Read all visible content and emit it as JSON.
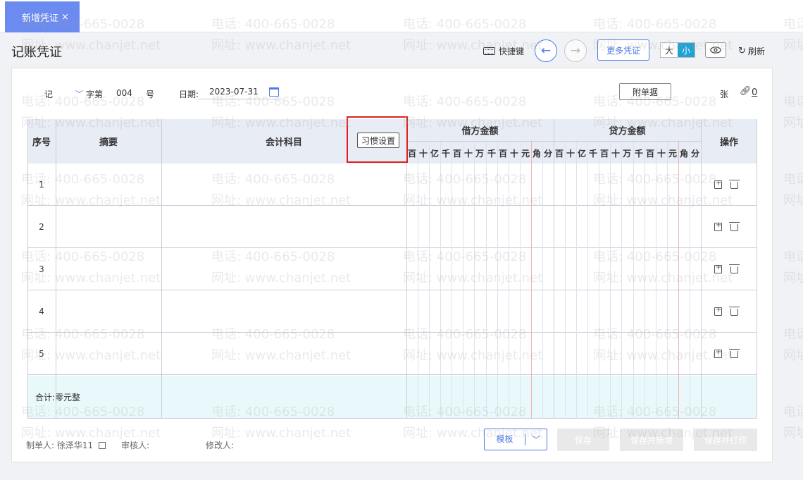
{
  "tab": {
    "label": "新增凭证",
    "close": "×"
  },
  "header": {
    "title": "记账凭证",
    "shortcut": "快捷键",
    "prev_icon": "arrow-left-icon",
    "next_icon": "arrow-right-icon",
    "more": "更多凭证",
    "size_large": "大",
    "size_small": "小",
    "refresh": "刷新"
  },
  "meta": {
    "voucher_type": "记",
    "zi": "字第",
    "number": "004",
    "hao": "号",
    "date_label": "日期:",
    "date": "2023-07-31",
    "attach_btn": "附单据",
    "zhang": "张",
    "attach_count": "0"
  },
  "table": {
    "col_seq": "序号",
    "col_summary": "摘要",
    "col_account": "会计科目",
    "habit_btn": "习惯设置",
    "col_debit": "借方金额",
    "col_credit": "贷方金额",
    "col_ops": "操作",
    "digits": [
      "百",
      "十",
      "亿",
      "千",
      "百",
      "十",
      "万",
      "千",
      "百",
      "十",
      "元",
      "角",
      "分"
    ],
    "rows": [
      {
        "seq": "1"
      },
      {
        "seq": "2"
      },
      {
        "seq": "3"
      },
      {
        "seq": "4"
      },
      {
        "seq": "5"
      }
    ],
    "total_label": "合计:零元整"
  },
  "footer": {
    "maker_label": "制单人:",
    "maker": "徐泽华11",
    "reviewer_label": "审核人:",
    "modifier_label": "修改人:",
    "template": "模板",
    "save": "保存",
    "save_new": "保存并新增",
    "save_print": "保存并打印"
  },
  "watermark": {
    "phone": "电话: 400-665-0028",
    "site": "网址: www.chanjet.net"
  },
  "colors": {
    "accent": "#4e7be8",
    "tab": "#6c8bf0",
    "toggle_on": "#1fa3d6",
    "highlight": "#e02020"
  }
}
